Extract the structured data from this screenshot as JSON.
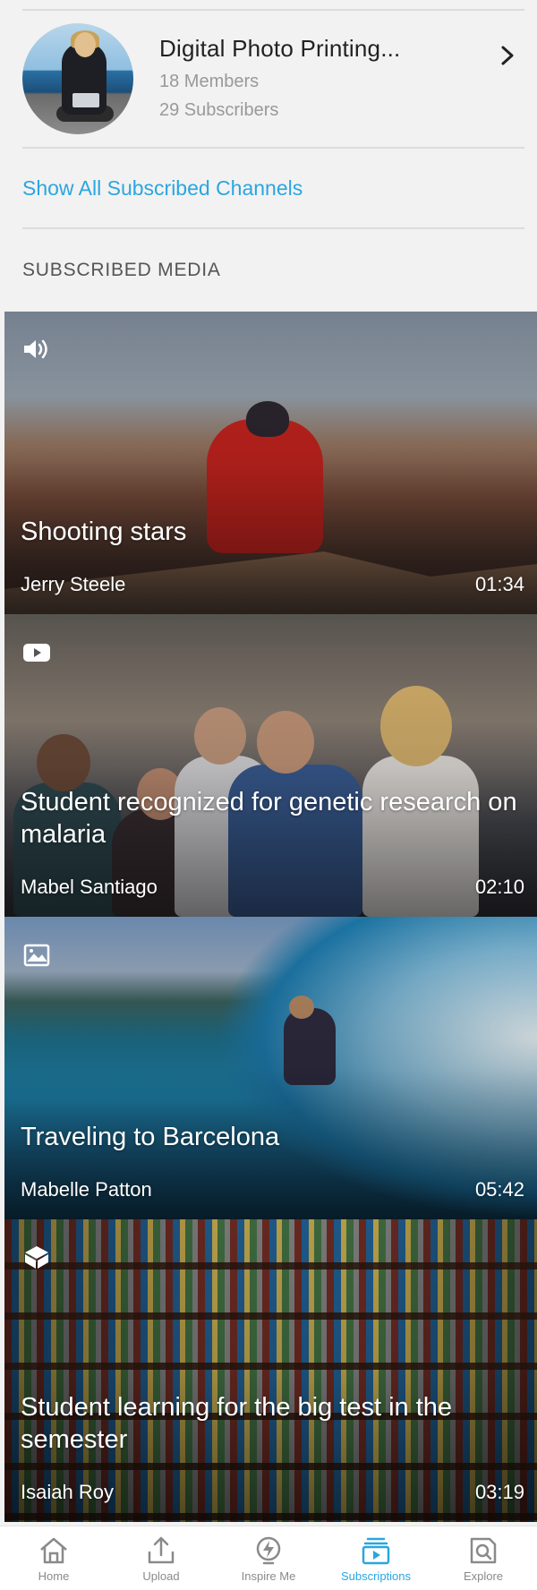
{
  "channel": {
    "name": "Digital Photo Printing...",
    "members": "18 Members",
    "subscribers": "29 Subscribers",
    "avatar_icon": "channel-avatar"
  },
  "show_all_label": "Show All Subscribed Channels",
  "section_title": "SUBSCRIBED MEDIA",
  "media": [
    {
      "type_icon": "audio-icon",
      "title": "Shooting stars",
      "author": "Jerry Steele",
      "duration": "01:34"
    },
    {
      "type_icon": "video-icon",
      "title": "Student recognized for genetic research on malaria",
      "author": "Mabel Santiago",
      "duration": "02:10"
    },
    {
      "type_icon": "image-icon",
      "title": "Traveling to Barcelona",
      "author": "Mabelle Patton",
      "duration": "05:42"
    },
    {
      "type_icon": "cube-icon",
      "title": "Student learning for the big test in the semester",
      "author": "Isaiah Roy",
      "duration": "03:19"
    }
  ],
  "tabs": [
    {
      "label": "Home",
      "icon": "home-icon",
      "active": false
    },
    {
      "label": "Upload",
      "icon": "upload-icon",
      "active": false
    },
    {
      "label": "Inspire Me",
      "icon": "lightning-icon",
      "active": false
    },
    {
      "label": "Subscriptions",
      "icon": "subscriptions-icon",
      "active": true
    },
    {
      "label": "Explore",
      "icon": "explore-icon",
      "active": false
    }
  ],
  "colors": {
    "accent": "#2aa6e0",
    "background": "#f2f2f2",
    "tab_inactive": "#8a8a8a"
  }
}
